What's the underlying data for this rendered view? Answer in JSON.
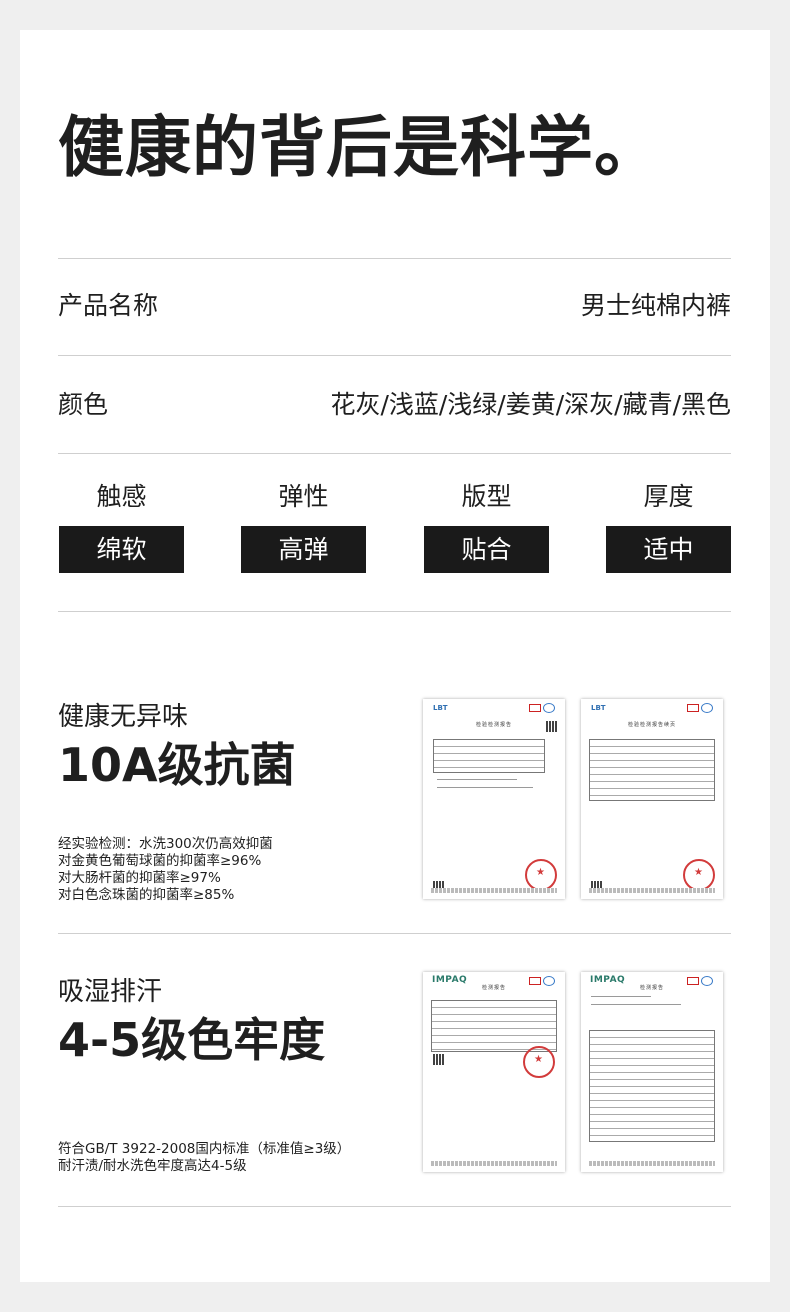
{
  "hero": {
    "title": "健康的背后是科学。"
  },
  "info_rows": [
    {
      "label": "产品名称",
      "value": "男士纯棉内裤"
    },
    {
      "label": "颜色",
      "value": "花灰/浅蓝/浅绿/姜黄/深灰/藏青/黑色"
    }
  ],
  "attributes": [
    {
      "name": "触感",
      "value": "绵软"
    },
    {
      "name": "弹性",
      "value": "高弹"
    },
    {
      "name": "版型",
      "value": "贴合"
    },
    {
      "name": "厚度",
      "value": "适中"
    }
  ],
  "sections": [
    {
      "subtitle": "健康无异味",
      "headline": "10A级抗菌",
      "notes": [
        "经实验检测：水洗300次仍高效抑菌",
        "对金黄色葡萄球菌的抑菌率≥96%",
        "对大肠杆菌的抑菌率≥97%",
        "对白色念珠菌的抑菌率≥85%"
      ],
      "documents": [
        {
          "kind": "检验检测报告"
        },
        {
          "kind": "检验检测报告续页"
        }
      ]
    },
    {
      "subtitle": "吸湿排汗",
      "headline": "4-5级色牢度",
      "notes": [
        "符合GB/T 3922-2008国内标准（标准值≥3级）",
        "耐汗渍/耐水洗色牢度高达4-5级"
      ],
      "documents": [
        {
          "brand": "IMPAQ",
          "kind": "检测报告"
        },
        {
          "brand": "IMPAQ",
          "kind": "检测报告"
        }
      ]
    }
  ],
  "colors": {
    "background": "#efefef",
    "card": "#ffffff",
    "box": "#1a1a1a",
    "text": "#1f1f1f",
    "rule": "#cfcfcf"
  }
}
